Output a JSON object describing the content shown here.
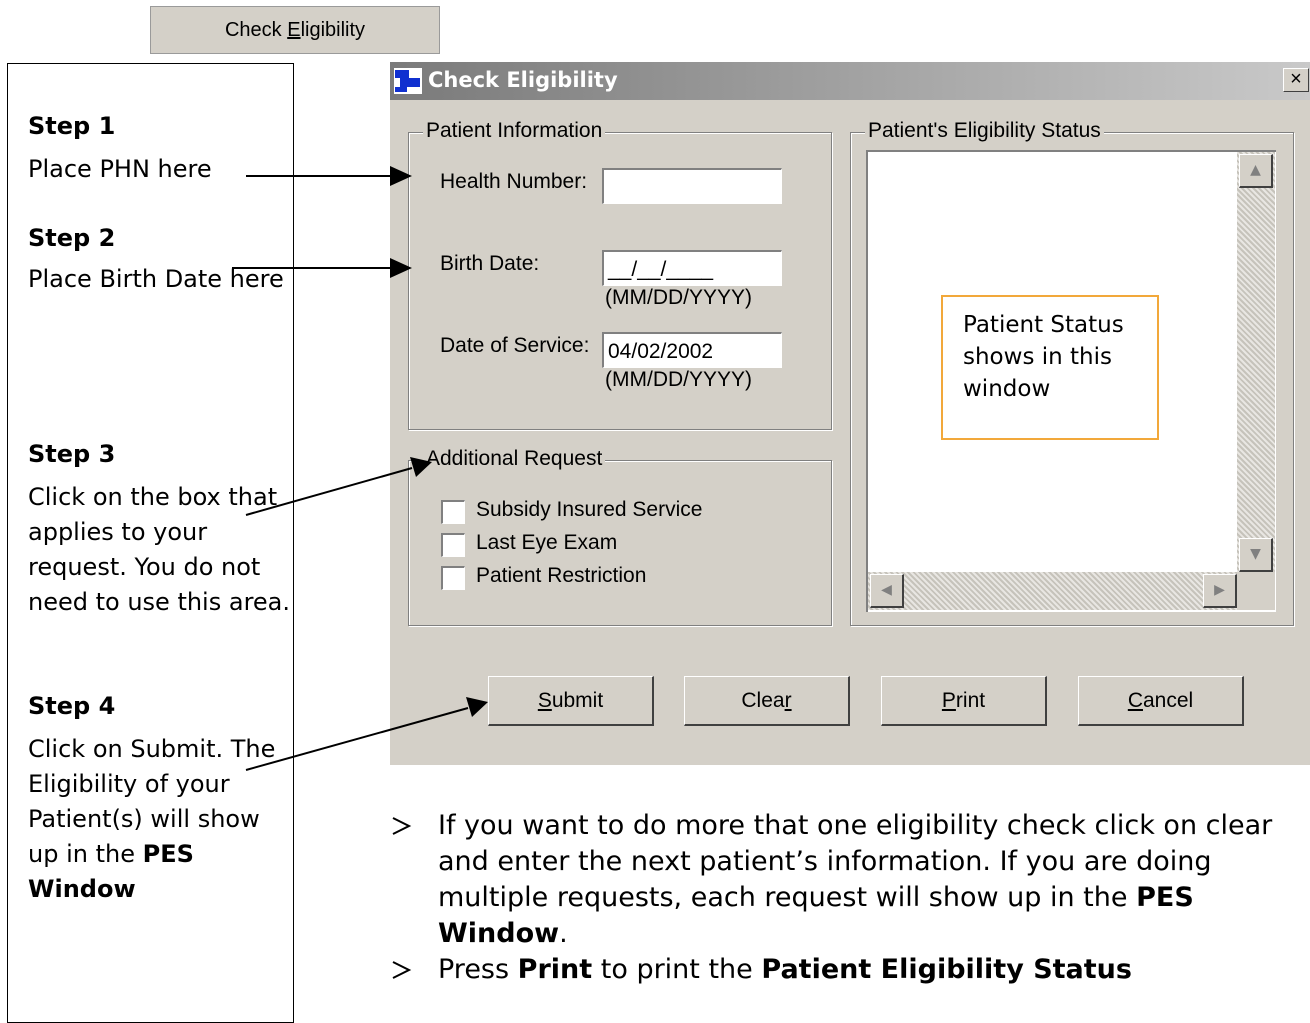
{
  "top_button": {
    "label_pre": "Check ",
    "label_key": "E",
    "label_post": "ligibility"
  },
  "steps": [
    {
      "title": "Step 1",
      "text": "Place PHN here"
    },
    {
      "title": "Step 2",
      "text": "Place Birth Date here"
    },
    {
      "title": "Step 3",
      "text": "Click on the box that applies to your request.  You do not need to use this area."
    },
    {
      "title": "Step 4",
      "text": "Click on Submit. The Eligibility of your Patient(s) will show up in the",
      "bold": "PES Window"
    }
  ],
  "dialog": {
    "title": "Check Eligibility",
    "close": "×",
    "patient_info": {
      "label": "Patient Information",
      "health_number_label": "Health Number:",
      "health_number_value": "",
      "birth_date_label": "Birth Date:",
      "birth_date_value": "__/__/____",
      "birth_date_hint": "(MM/DD/YYYY)",
      "service_date_label": "Date of Service:",
      "service_date_value": "04/02/2002",
      "service_date_hint": "(MM/DD/YYYY)"
    },
    "additional": {
      "label": "Additional Request",
      "options": [
        "Subsidy Insured Service",
        "Last Eye Exam",
        "Patient Restriction"
      ]
    },
    "status": {
      "label": "Patient's Eligibility Status",
      "note": "Patient Status shows in this window"
    },
    "buttons": [
      {
        "key": "S",
        "rest": "ubmit"
      },
      {
        "pre": "Clea",
        "key": "r"
      },
      {
        "key": "P",
        "rest": "rint"
      },
      {
        "key": "C",
        "rest": "ancel"
      }
    ]
  },
  "bullets": [
    {
      "text": "If you want to do more that one eligibility check click on clear and enter the next patient’s information.  If you are doing multiple requests, each request will show up in the",
      "bold": "PES Window",
      "suffix": "."
    },
    {
      "pre": "Press",
      "bold1": "Print",
      "mid": "to print the",
      "bold2": "Patient Eligibility Status"
    }
  ],
  "colors": {
    "dialog_bg": "#d4d0c8",
    "note_border": "#f2a83a"
  },
  "icons": {
    "bullet": "arrowhead-bullet-icon",
    "dialog": "app-icon",
    "close": "close-icon"
  }
}
